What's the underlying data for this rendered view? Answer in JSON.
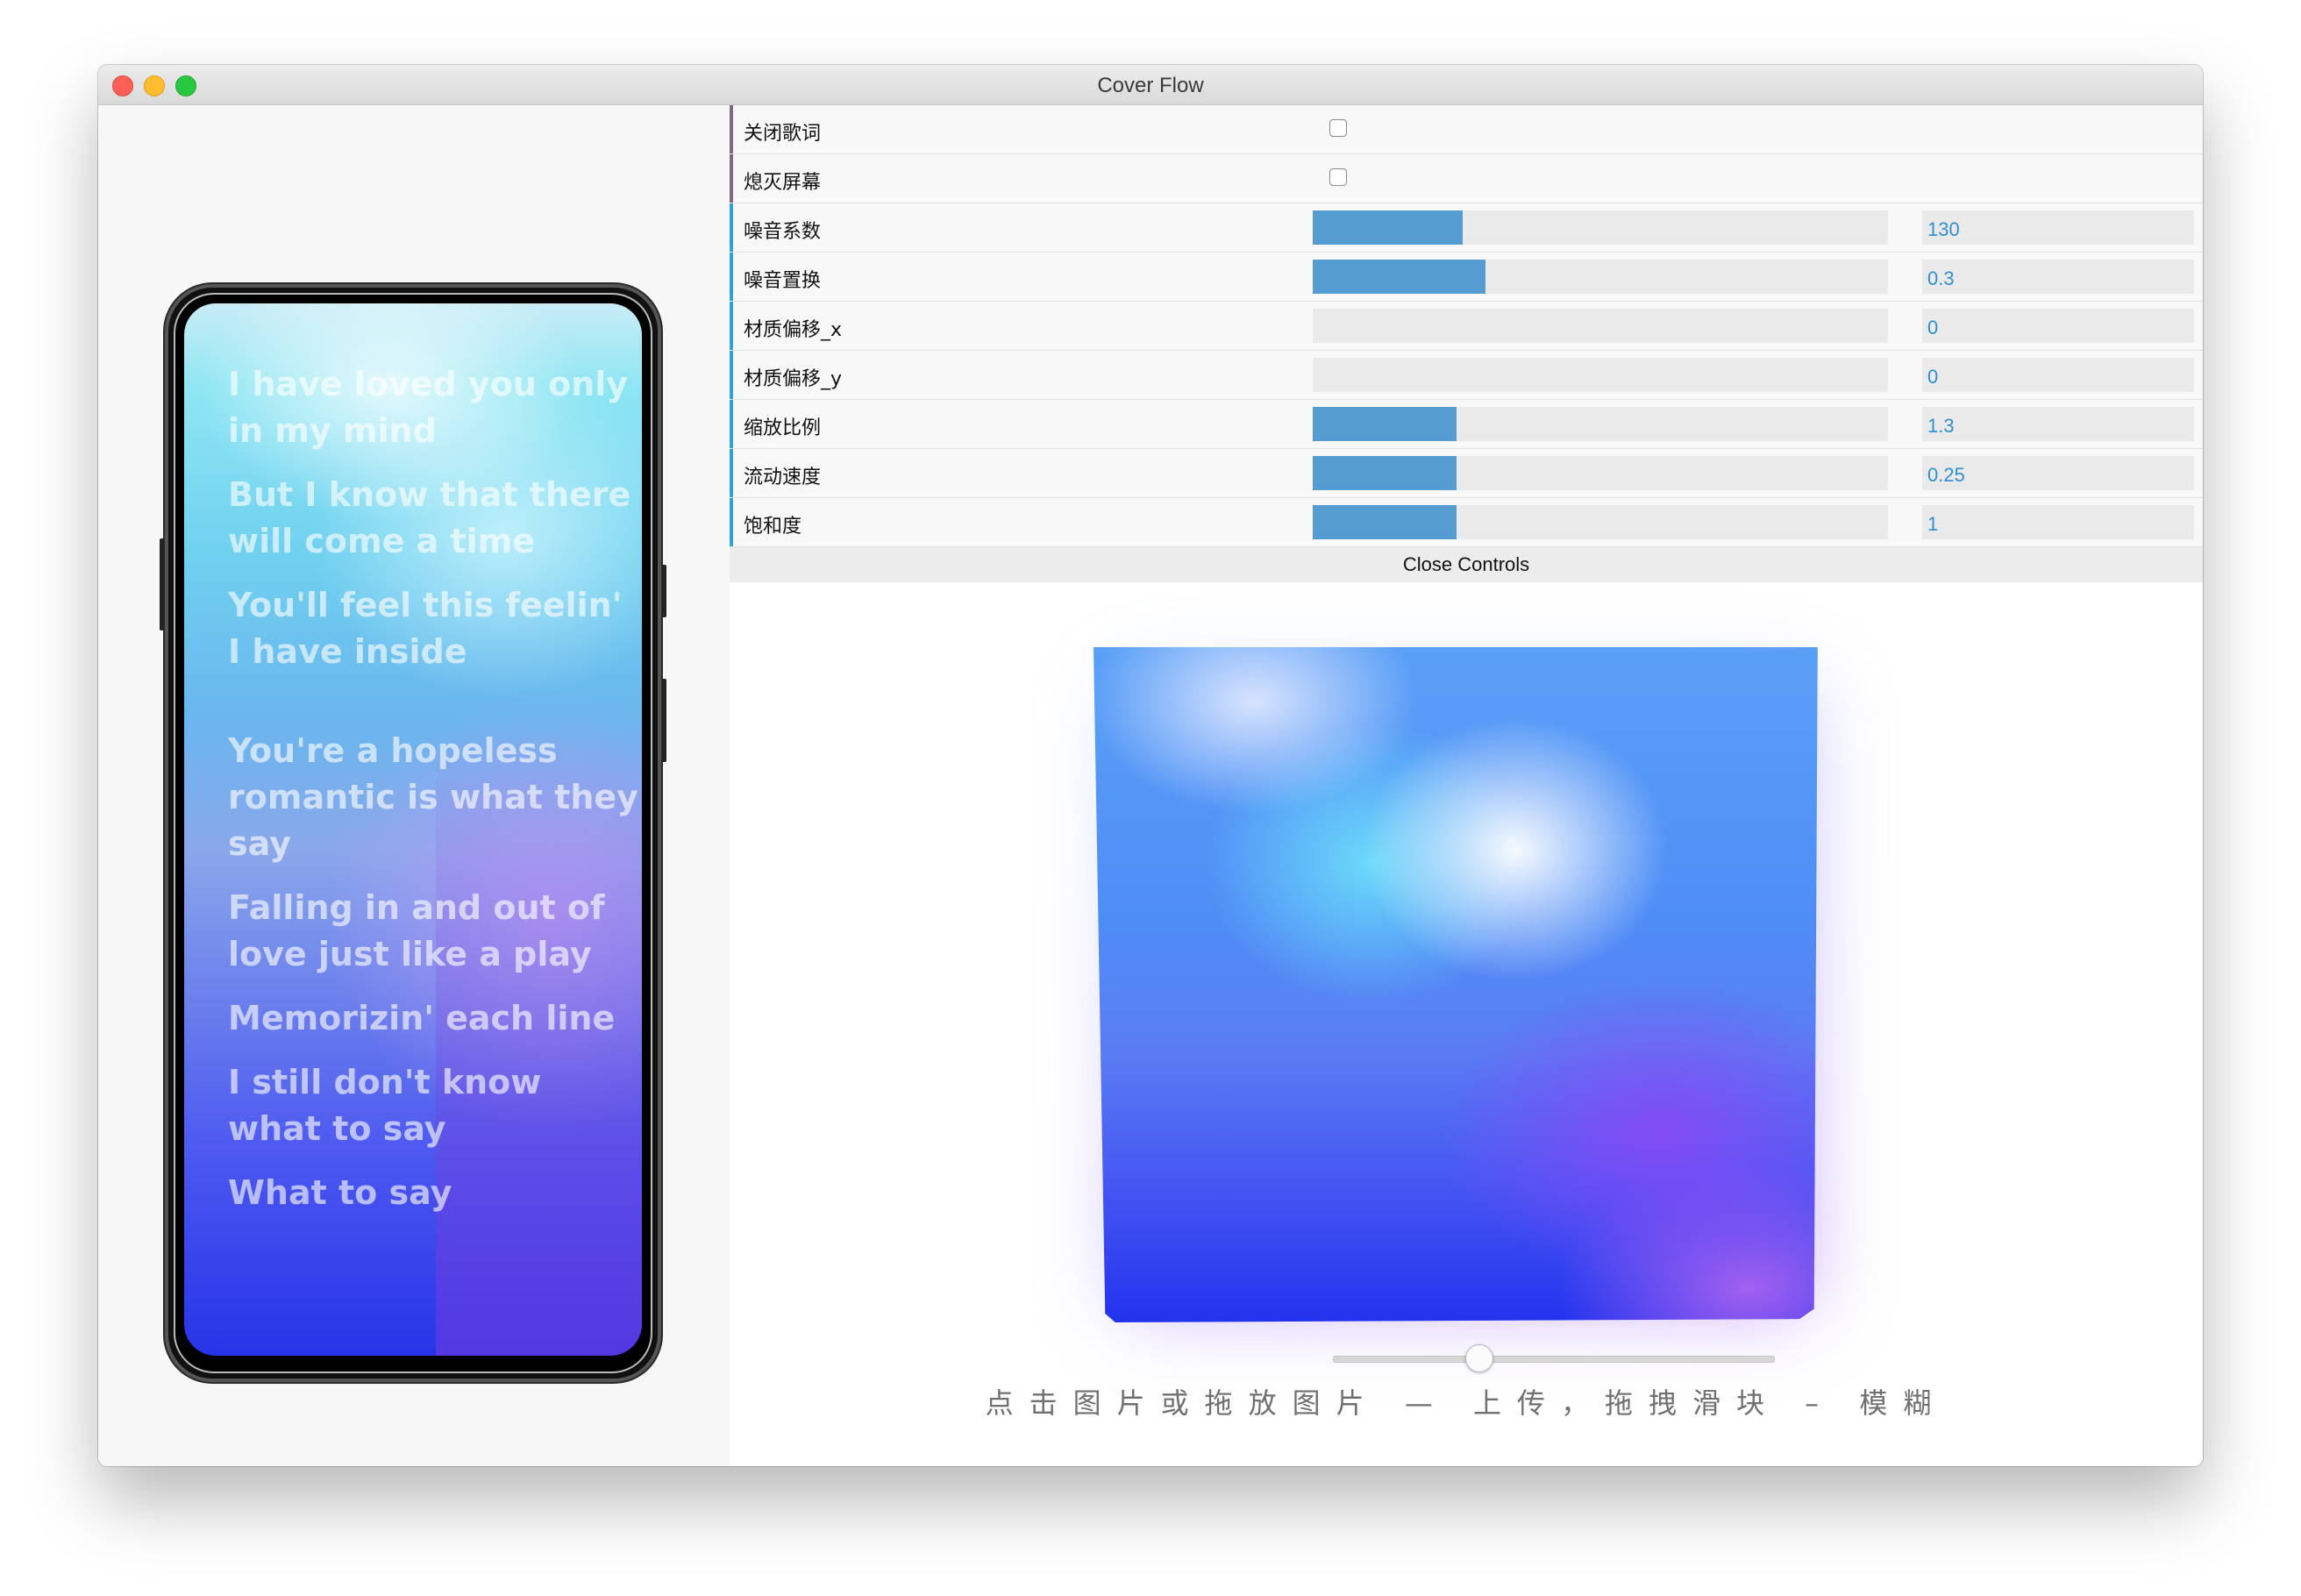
{
  "window": {
    "title": "Cover Flow"
  },
  "lyrics": [
    "I have loved you only in my mind",
    "But I know that there will come a time",
    "You'll feel this feelin' I have inside",
    "You're a hopeless romantic is what they say",
    "Falling in and out of love just like a play",
    "Memorizin' each line",
    "I still don't know what to say",
    "What to say"
  ],
  "controls": {
    "rows": [
      {
        "label": "关闭歌词",
        "type": "checkbox",
        "checked": false
      },
      {
        "label": "熄灭屏幕",
        "type": "checkbox",
        "checked": false
      },
      {
        "label": "噪音系数",
        "type": "slider",
        "value": "130",
        "fill": 0.26
      },
      {
        "label": "噪音置换",
        "type": "slider",
        "value": "0.3",
        "fill": 0.3
      },
      {
        "label": "材质偏移_x",
        "type": "slider",
        "value": "0",
        "fill": 0
      },
      {
        "label": "材质偏移_y",
        "type": "slider",
        "value": "0",
        "fill": 0
      },
      {
        "label": "缩放比例",
        "type": "slider",
        "value": "1.3",
        "fill": 0.25
      },
      {
        "label": "流动速度",
        "type": "slider",
        "value": "0.25",
        "fill": 0.25
      },
      {
        "label": "饱和度",
        "type": "slider",
        "value": "1",
        "fill": 0.25
      }
    ],
    "close_label": "Close Controls"
  },
  "blur_slider": {
    "value": 0.32
  },
  "hint": "点击图片或拖放图片 — 上传，拖拽滑块 – 模糊",
  "colors": {
    "bool_accent": "#806787",
    "number_accent": "#2fa1d6",
    "slider_fill": "#559dd0",
    "value_text": "#2f8fd0"
  }
}
